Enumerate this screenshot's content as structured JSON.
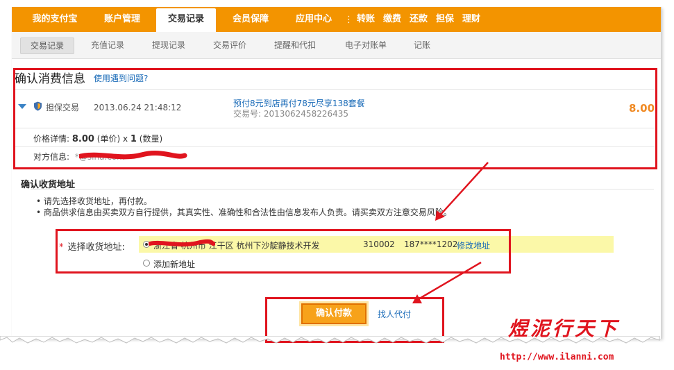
{
  "colors": {
    "nav_bg": "#f39400",
    "accent_red": "#e0141e",
    "link": "#1a6bb8",
    "price": "#f08a24",
    "highlight": "#fbf8a8"
  },
  "topnav": {
    "tabs": [
      "我的支付宝",
      "账户管理",
      "交易记录",
      "会员保障",
      "应用中心"
    ],
    "active": "交易记录",
    "quick_links": [
      "转账",
      "缴费",
      "还款",
      "担保",
      "理财"
    ]
  },
  "subnav": {
    "items": [
      "交易记录",
      "充值记录",
      "提现记录",
      "交易评价",
      "提醒和代扣",
      "电子对账单",
      "记账"
    ],
    "active": "交易记录"
  },
  "confirm": {
    "title": "确认消费信息",
    "help_link": "使用遇到问题?",
    "order": {
      "type": "担保交易",
      "time": "2013.06.24 21:48:12",
      "product": "预付8元到店再付78元尽享138套餐",
      "order_no": "交易号: 2013062458226435",
      "amount": "8.00"
    },
    "price_detail": {
      "label": "价格详情:",
      "unit_price": "8.00",
      "unit_suffix": "(单价) x",
      "qty": "1",
      "qty_suffix": "(数量)"
    },
    "counterparty": {
      "label": "对方信息:",
      "value": "*@sina.com"
    }
  },
  "address": {
    "title": "确认收货地址",
    "notes": [
      "• 请先选择收货地址，再付款。",
      "• 商品供求信息由买卖双方自行提供，其真实性、准确性和合法性由信息发布人负责。请买卖双方注意交易风险。"
    ],
    "select_label": "选择收货地址:",
    "selected": {
      "address": "浙江省 杭州市 江干区 杭州下沙靛静技术开发",
      "zip": "310002",
      "phone": "187****1202",
      "edit_link": "修改地址"
    },
    "add_new": "添加新地址"
  },
  "actions": {
    "pay_button": "确认付款",
    "proxy_link": "找人代付"
  },
  "watermark": {
    "text": "煜泥行天下",
    "url": "http://www.ilanni.com"
  }
}
